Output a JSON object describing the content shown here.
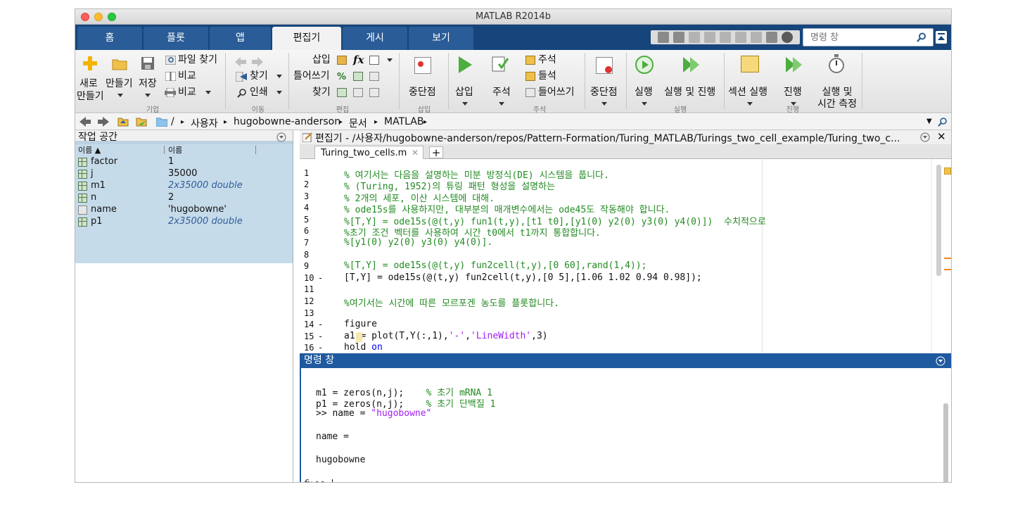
{
  "window": {
    "title": "MATLAB R2014b"
  },
  "tabs": [
    {
      "label": "홈"
    },
    {
      "label": "플롯"
    },
    {
      "label": "앱"
    },
    {
      "label": "편집기"
    },
    {
      "label": "게시"
    },
    {
      "label": "보기"
    }
  ],
  "search": {
    "placeholder": "명령 창"
  },
  "ribbon": {
    "file": {
      "new_l1": "새로",
      "new_l2": "만들기",
      "open": "만들기",
      "save": "저장",
      "find_files": "파일 찾기",
      "compare": "비교",
      "print": "비교",
      "group": "기업"
    },
    "navigate": {
      "goto": "찾기",
      "find": "인쇄",
      "group": "이동"
    },
    "edit": {
      "insert": "삽입",
      "indent": "틀어쓰기",
      "find": "찾기",
      "group": "편집"
    },
    "breakpoints": {
      "label": "중단점",
      "group": "삽입"
    },
    "insert_run": {
      "insert": "삽입",
      "comment": "주석"
    },
    "comment_group": {
      "comment": "주석",
      "uncomment": "들석",
      "indent": "들어쓰기",
      "group": "주석"
    },
    "bp2": {
      "label": "중단점"
    },
    "run": {
      "run": "실행",
      "run_advance": "실행 및 진행",
      "group": "실행"
    },
    "section": {
      "run_section": "섹션 실행",
      "advance": "진행",
      "run_time_l1": "실행 및",
      "run_time_l2": "시간 측정",
      "group": "진행"
    }
  },
  "address": {
    "path": [
      "/",
      "사용자",
      "hugobowne-anderson",
      "문서",
      "MATLAB"
    ]
  },
  "workspace": {
    "title": "작업 공간",
    "col_name": "이름 ▲",
    "col_value": "이름",
    "vars": [
      {
        "name": "factor",
        "value": "1",
        "italic": false
      },
      {
        "name": "j",
        "value": "35000",
        "italic": false
      },
      {
        "name": "m1",
        "value": "2x35000 double",
        "italic": true
      },
      {
        "name": "n",
        "value": "2",
        "italic": false
      },
      {
        "name": "name",
        "value": "'hugobowne'",
        "italic": false
      },
      {
        "name": "p1",
        "value": "2x35000 double",
        "italic": true
      }
    ]
  },
  "editor": {
    "title": "편집기 - /사용자/hugobowne-anderson/repos/Pattern-Formation/Turing_MATLAB/Turings_two_cell_example/Turing_two_c...",
    "tab": "Turing_two_cells.m",
    "plus": "+",
    "lines": [
      {
        "n": "1",
        "d": "",
        "t": "% 여기서는 다음을 설명하는 미분 방정식(DE) 시스템을 풉니다."
      },
      {
        "n": "2",
        "d": "",
        "t": "% (Turing, 1952)의 튜링 패턴 형성을 설명하는"
      },
      {
        "n": "3",
        "d": "",
        "t": "% 2개의 세포, 이산 시스템에 대해."
      },
      {
        "n": "4",
        "d": "",
        "t": "% ode15s를 사용하지만, 대부분의 매개변수에서는 ode45도 작동해야 합니다."
      },
      {
        "n": "5",
        "d": "",
        "t": "%[T,Y] = ode15s(@(t,y) fun1(t,y),[t1 t0],[y1(0) y2(0) y3(0) y4(0)])  수치적으로"
      },
      {
        "n": "6",
        "d": "",
        "t": "%초기 조건 벡터를 사용하여 시간 t0에서 t1까지 통합합니다."
      },
      {
        "n": "7",
        "d": "",
        "t": "%[y1(0) y2(0) y3(0) y4(0)]."
      },
      {
        "n": "8",
        "d": "",
        "t": ""
      },
      {
        "n": "9",
        "d": "",
        "t": "%[T,Y] = ode15s(@(t,y) fun2cell(t,y),[0 60],rand(1,4));"
      },
      {
        "n": "10",
        "d": "-",
        "t": "[T,Y] = ode15s(@(t,y) fun2cell(t,y),[0 5],[1.06 1.02 0.94 0.98]);"
      },
      {
        "n": "11",
        "d": "",
        "t": ""
      },
      {
        "n": "12",
        "d": "",
        "t": "%여기서는 시간에 따른 모르포겐 농도를 플롯합니다."
      },
      {
        "n": "13",
        "d": "",
        "t": ""
      },
      {
        "n": "14",
        "d": "-",
        "t": "figure"
      },
      {
        "n": "15",
        "d": "-",
        "t_a": "a1 = plot(T,Y(:,1),",
        "t_s1": "'-'",
        "t_b": ",",
        "t_s2": "'LineWidth'",
        "t_c": ",3)"
      },
      {
        "n": "16",
        "d": "-",
        "t_a": "hold ",
        "t_kw": "on"
      }
    ]
  },
  "command": {
    "title": "명령 창",
    "lines": [
      {
        "a": "m1 = zeros(n,j);    ",
        "c": "% 초기 mRNA 1"
      },
      {
        "a": "p1 = zeros(n,j);    ",
        "c": "% 초기 단백질 1"
      },
      {
        "a": ">> name = ",
        "s": "\"hugobowne\""
      },
      {
        "a": ""
      },
      {
        "a": "name ="
      },
      {
        "a": ""
      },
      {
        "a": "hugobowne"
      }
    ],
    "prompt": ">>",
    "fx": "fx"
  },
  "colors": {
    "tabstrip": "#16457c",
    "tab": "#2a5c97",
    "cmdbar": "#1f5aa0",
    "comment": "#228b22",
    "string": "#a020f0"
  }
}
